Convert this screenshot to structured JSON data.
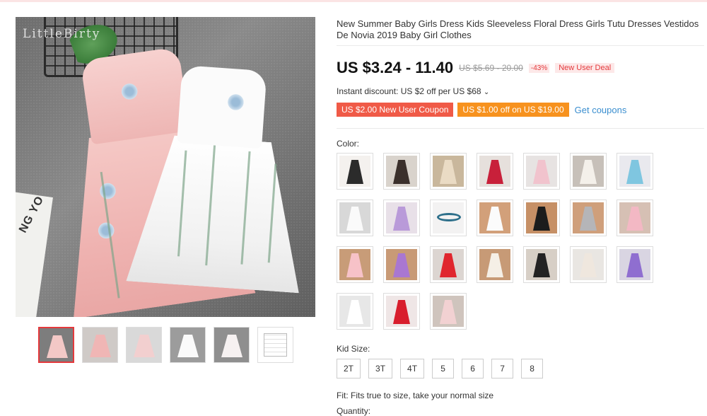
{
  "product": {
    "title": "New Summer Baby Girls Dress Kids Sleeveless Floral Dress Girls Tutu Dresses Vestidos De Novia 2019 Baby Girl Clothes",
    "brand_watermark": "LittleBirty",
    "photo_text": "NG YO",
    "price": "US $3.24 - 11.40",
    "original_price": "US $5.69 - 20.00",
    "discount_pct": "-43%",
    "deal_badge": "New User Deal",
    "instant_discount": "Instant discount: US $2 off per US $68",
    "instant_discount_chevron": "⌄"
  },
  "coupons": {
    "red": "US $2.00 New User Coupon",
    "orange": "US $1.00 off on US $19.00",
    "get": "Get coupons"
  },
  "color_label": "Color:",
  "swatches": [
    {
      "name": "black-beige-dress",
      "bg": "#f4f1ee",
      "dress": "#2b2b2b"
    },
    {
      "name": "dark-lace-dress",
      "bg": "#d9d3cc",
      "dress": "#3b302c"
    },
    {
      "name": "champagne-dress",
      "bg": "#c9b79c",
      "dress": "#eadbc4"
    },
    {
      "name": "red-dress",
      "bg": "#e6e0dc",
      "dress": "#c8203a"
    },
    {
      "name": "pink-dress",
      "bg": "#e7e3e2",
      "dress": "#f1c3cd"
    },
    {
      "name": "white-lace-dress",
      "bg": "#c7c0b9",
      "dress": "#f4f0ea"
    },
    {
      "name": "rainbow-dress",
      "bg": "#e9e9ee",
      "dress": "#7fc6e0"
    },
    {
      "name": "white-tiered-dress",
      "bg": "#d8d8d8",
      "dress": "#fafafa"
    },
    {
      "name": "lilac-dress",
      "bg": "#e8e0e8",
      "dress": "#b99ad9"
    },
    {
      "name": "headband",
      "bg": "#f3f2f2",
      "dress": "transparent"
    },
    {
      "name": "white-tulle-dress",
      "bg": "#d2a07a",
      "dress": "#fbfbfb"
    },
    {
      "name": "black-tulle-dress",
      "bg": "#c69066",
      "dress": "#1c1c1c"
    },
    {
      "name": "grey-dress",
      "bg": "#cf9f7b",
      "dress": "#b5b5b8"
    },
    {
      "name": "pink-tulle-dress",
      "bg": "#d6c0b4",
      "dress": "#f3b8c4"
    },
    {
      "name": "peach-dress",
      "bg": "#c89c78",
      "dress": "#f7c2c8"
    },
    {
      "name": "purple-dress",
      "bg": "#c89a76",
      "dress": "#a977d1"
    },
    {
      "name": "red-tulle-dress",
      "bg": "#dcd5d1",
      "dress": "#e0262e"
    },
    {
      "name": "ivory-dress",
      "bg": "#c79a76",
      "dress": "#f5efe6"
    },
    {
      "name": "black-print-dress",
      "bg": "#d7cfc6",
      "dress": "#232323"
    },
    {
      "name": "floral-print-dress",
      "bg": "#e9e6e2",
      "dress": "#efe7de"
    },
    {
      "name": "purple-tulle-dress",
      "bg": "#d9d5e2",
      "dress": "#8f6ed0"
    },
    {
      "name": "white-party-dress",
      "bg": "#e7e7e7",
      "dress": "#ffffff"
    },
    {
      "name": "red-party-dress",
      "bg": "#efe6e6",
      "dress": "#d81e2d"
    },
    {
      "name": "blush-dress",
      "bg": "#cfc4bd",
      "dress": "#f2d1d2"
    }
  ],
  "thumbnails": [
    {
      "bg": "#7d7d7d",
      "dress": "#f3c8c6"
    },
    {
      "bg": "#cfcac7",
      "dress": "#f0b6b5"
    },
    {
      "bg": "#d9d9d9",
      "dress": "#f2cfcf"
    },
    {
      "bg": "#9c9c9c",
      "dress": "#fafafa"
    },
    {
      "bg": "#8f8f8f",
      "dress": "#f6f1f1"
    },
    {
      "bg": "#ffffff",
      "dress": "doc"
    }
  ],
  "size_label": "Kid Size:",
  "sizes": [
    "2T",
    "3T",
    "4T",
    "5",
    "6",
    "7",
    "8"
  ],
  "fit_text": "Fit: Fits true to size, take your normal size",
  "quantity_label": "Quantity:"
}
